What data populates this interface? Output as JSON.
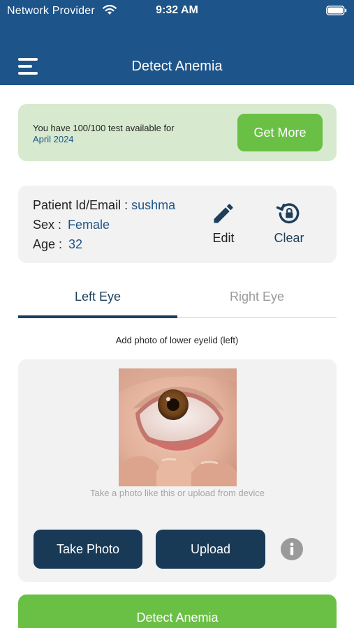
{
  "status_bar": {
    "carrier": "Network Provider",
    "time": "9:32 AM"
  },
  "header": {
    "title": "Detect Anemia"
  },
  "quota": {
    "text": "You have 100/100 test available for",
    "month": "April 2024",
    "get_more_label": "Get More"
  },
  "patient": {
    "id_label": "Patient Id/Email :",
    "id_value": "sushma",
    "sex_label": "Sex :",
    "sex_value": "Female",
    "age_label": "Age :",
    "age_value": "32",
    "edit_label": "Edit",
    "clear_label": "Clear"
  },
  "tabs": [
    {
      "label": "Left Eye",
      "active": true
    },
    {
      "label": "Right Eye",
      "active": false
    }
  ],
  "instruction": "Add photo of lower eyelid (left)",
  "photo": {
    "hint": "Take a photo like this or upload from device",
    "take_photo_label": "Take Photo",
    "upload_label": "Upload"
  },
  "detect_label": "Detect Anemia",
  "colors": {
    "header": "#1d5489",
    "accent_green": "#6abf45",
    "banner_bg": "#d7eacf",
    "dark_button": "#183a56"
  }
}
